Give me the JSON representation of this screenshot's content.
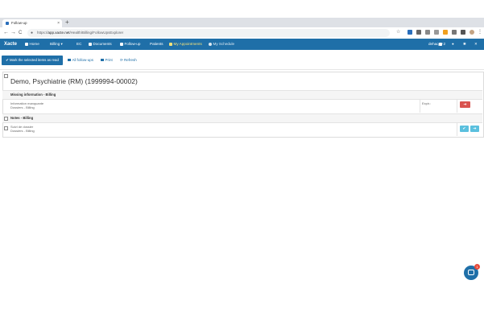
{
  "browser": {
    "tab_title": "Follow-up",
    "tab_close": "×",
    "new_tab": "+",
    "back": "←",
    "forward": "→",
    "reload": "C",
    "url_prefix": "https://",
    "url_host": "app.xacte.net",
    "url_path": "/Health/Billing/FollowUpsExplorer"
  },
  "nav": {
    "brand": "Xacte",
    "items": [
      {
        "label": "Home"
      },
      {
        "label": "Billing"
      },
      {
        "label": "EC"
      },
      {
        "label": "Documents"
      },
      {
        "label": "Follow-up"
      },
      {
        "label": "Patients"
      },
      {
        "label": "My Appointments"
      },
      {
        "label": "My Schedule"
      }
    ],
    "user": "dehaquy",
    "messages_count": "2"
  },
  "actions": {
    "mark_read": "Mark the selected items as read",
    "all_followups": "All follow-ups",
    "print": "Print",
    "refresh": "Refresh"
  },
  "patient": {
    "name": "Demo, Psychiatrie (RM) (1999994-00002)"
  },
  "sections": [
    {
      "title": "Missing information - Billing",
      "item_title": "Information manquante",
      "item_sub": "Dossiers - Billing",
      "expiry": "Expir.:"
    },
    {
      "title": "Notes - Billing",
      "item_title": "Suivi de dossier",
      "item_sub": "Dossiers - Billing"
    }
  ],
  "chat": {
    "badge": "1"
  },
  "colors": {
    "primary": "#1f6fa8",
    "danger": "#d9534f",
    "info": "#5bc0de",
    "highlight": "#f4e27a"
  }
}
